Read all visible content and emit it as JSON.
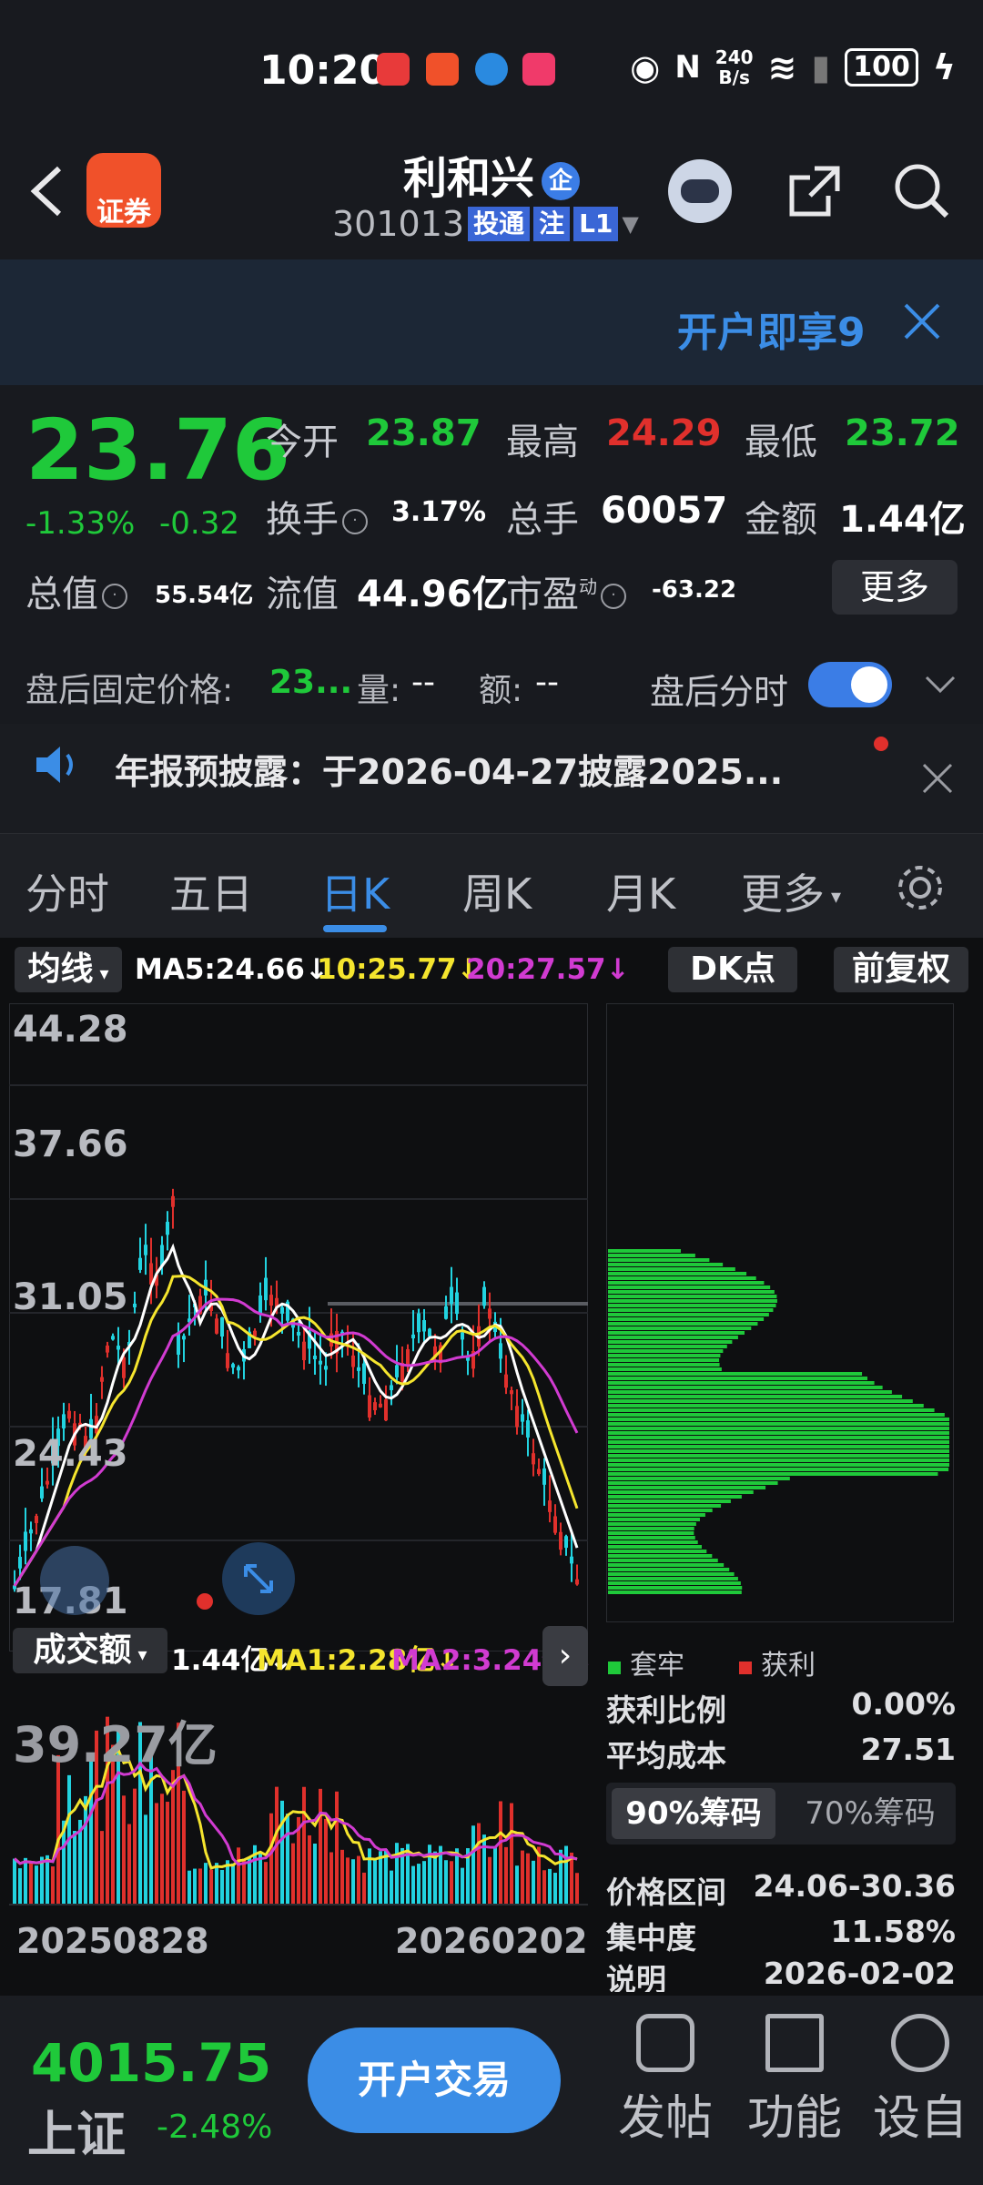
{
  "status": {
    "time": "10:20",
    "speed": "240\nB/s",
    "speed_a": "240",
    "speed_b": "B/s",
    "battery": "100"
  },
  "header": {
    "name": "利和兴",
    "badge": "企",
    "code": "301013",
    "tag1": "投通",
    "tag2": "注",
    "tag3": "L1",
    "logo_text": "证券"
  },
  "banner": {
    "text": "开户即享9"
  },
  "quote": {
    "price": "23.76",
    "pct": "-1.33%",
    "change": "-0.32",
    "open_label": "今开",
    "open": "23.87",
    "high_label": "最高",
    "high": "24.29",
    "low_label": "最低",
    "low": "23.72",
    "turnover_label": "换手",
    "turnover": "3.17%",
    "volume_label": "总手",
    "volume": "60057",
    "amount_label": "金额",
    "amount": "1.44亿",
    "mcap_label": "总值",
    "mcap": "55.54亿",
    "float_label": "流值",
    "float": "44.96亿",
    "pe_label": "市盈",
    "pe_sup": "动",
    "pe": "-63.22",
    "more": "更多"
  },
  "after": {
    "fixed_label": "盘后固定价格:",
    "fixed": "23...",
    "vol_label": "量:",
    "vol": "--",
    "amt_label": "额:",
    "amt": "--",
    "toggle_label": "盘后分时"
  },
  "notice": {
    "text": "年报预披露：于2026-04-27披露2025..."
  },
  "tabs": [
    "分时",
    "五日",
    "日K",
    "周K",
    "月K",
    "更多"
  ],
  "chart": {
    "ma_btn": "均线",
    "ma5": "MA5:24.66↓",
    "ma10": "10:25.77↓",
    "ma20": "20:27.57↓",
    "dk": "DK点",
    "fq": "前复权",
    "price_labels": [
      "44.28",
      "37.66",
      "31.05",
      "24.43",
      "17.81"
    ],
    "vol_btn": "成交额",
    "vol_now": "1.44亿↓",
    "vol_ma1": "MA1:2.28亿↓",
    "vol_ma2": "MA2:3.24亿↓",
    "vol_max": "39.27亿",
    "date_start": "20250828",
    "date_end": "20260202"
  },
  "chips": {
    "trap_label": "套牢",
    "profit_label": "获利",
    "profit_ratio_label": "获利比例",
    "profit_ratio": "0.00%",
    "avg_cost_label": "平均成本",
    "avg_cost": "27.51",
    "tab90": "90%筹码",
    "tab70": "70%筹码",
    "range_label": "价格区间",
    "range": "24.06-30.36",
    "conc_label": "集中度",
    "conc": "11.58%",
    "note_label": "说明",
    "note": "2026-02-02"
  },
  "colors": {
    "up": "#e0302c",
    "down": "#1fc93a",
    "accent": "#3b8de6",
    "ma5": "#ffffff",
    "ma10": "#f5e52e",
    "ma20": "#d13bd1"
  },
  "bottom": {
    "index_value": "4015.75",
    "index_name": "上证",
    "index_pct": "-2.48%",
    "open_btn": "开户交易",
    "post": "发帖",
    "func": "功能",
    "settings": "设自"
  }
}
